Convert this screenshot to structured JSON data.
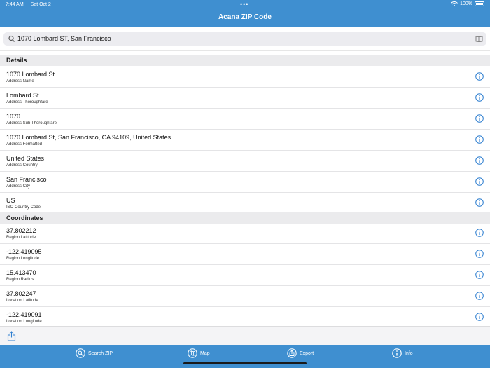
{
  "status_bar": {
    "time": "7:44 AM",
    "date": "Sat Oct 2",
    "dots": "•••",
    "battery": "100%"
  },
  "app_title": "Acana ZIP Code",
  "search": {
    "value": "1070 Lombard ST, San Francisco"
  },
  "sections": {
    "details": "Details",
    "coordinates": "Coordinates"
  },
  "details": [
    {
      "value": "1070 Lombard St",
      "label": "Address Name"
    },
    {
      "value": "Lombard St",
      "label": "Address Thoroughfare"
    },
    {
      "value": "1070",
      "label": "Address Sub Thoroughfare"
    },
    {
      "value": "1070 Lombard St, San Francisco, CA  94109, United States",
      "label": "Address Formatted"
    },
    {
      "value": "United States",
      "label": "Address Country"
    },
    {
      "value": "San Francisco",
      "label": "Address City"
    },
    {
      "value": "US",
      "label": "ISO Country Code"
    }
  ],
  "coordinates": [
    {
      "value": "37.802212",
      "label": "Region Latitude"
    },
    {
      "value": "-122.419095",
      "label": "Region Longitude"
    },
    {
      "value": "15.413470",
      "label": "Region Radius"
    },
    {
      "value": "37.802247",
      "label": "Location Latitude"
    },
    {
      "value": "-122.419091",
      "label": "Location Longitude"
    }
  ],
  "tabs": [
    {
      "label": "Search ZIP",
      "icon": "magnifier-icon"
    },
    {
      "label": "Map",
      "icon": "map-icon"
    },
    {
      "label": "Export",
      "icon": "export-icon"
    },
    {
      "label": "Info",
      "icon": "info-icon"
    }
  ],
  "colors": {
    "accent": "#3f8fd0",
    "info_button": "#2f7fd0",
    "section_bg": "#ebebed"
  }
}
